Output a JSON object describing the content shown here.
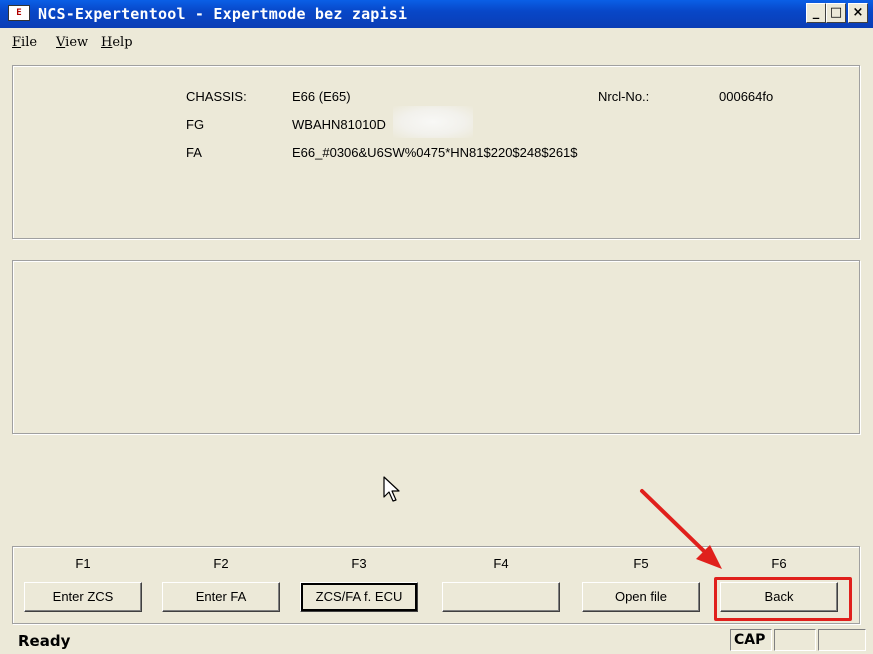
{
  "window": {
    "title": "NCS-Expertentool - Expertmode bez zapisi",
    "icon_text": "E",
    "controls": {
      "minimize": "_",
      "maximize": "□",
      "close": "×"
    }
  },
  "menu": {
    "items": [
      {
        "first": "F",
        "rest": "ile"
      },
      {
        "first": "V",
        "rest": "iew"
      },
      {
        "first": "H",
        "rest": "elp"
      }
    ]
  },
  "vehicle_info": {
    "chassis_label": "CHASSIS:",
    "chassis_value": "E66 (E65)",
    "fg_label": "FG",
    "fg_value": "WBAHN81010D",
    "fa_label": "FA",
    "fa_value": "E66_#0306&U6SW%0475*HN81$220$248$261$",
    "nrcl_label": "Nrcl-No.:",
    "nrcl_value": "000664fo"
  },
  "function_keys": [
    {
      "key": "F1",
      "label": "Enter ZCS",
      "focused": false
    },
    {
      "key": "F2",
      "label": "Enter FA",
      "focused": false
    },
    {
      "key": "F3",
      "label": "ZCS/FA f. ECU",
      "focused": true
    },
    {
      "key": "F4",
      "label": "",
      "focused": false
    },
    {
      "key": "F5",
      "label": "Open file",
      "focused": false
    },
    {
      "key": "F6",
      "label": "Back",
      "focused": false
    }
  ],
  "status": {
    "text": "Ready",
    "cap": "CAP",
    "num": "",
    "scroll": ""
  },
  "colors": {
    "title_bar": "#0A4FD6",
    "annotation": "#E0201C",
    "window_bg": "#ECE9D8"
  }
}
